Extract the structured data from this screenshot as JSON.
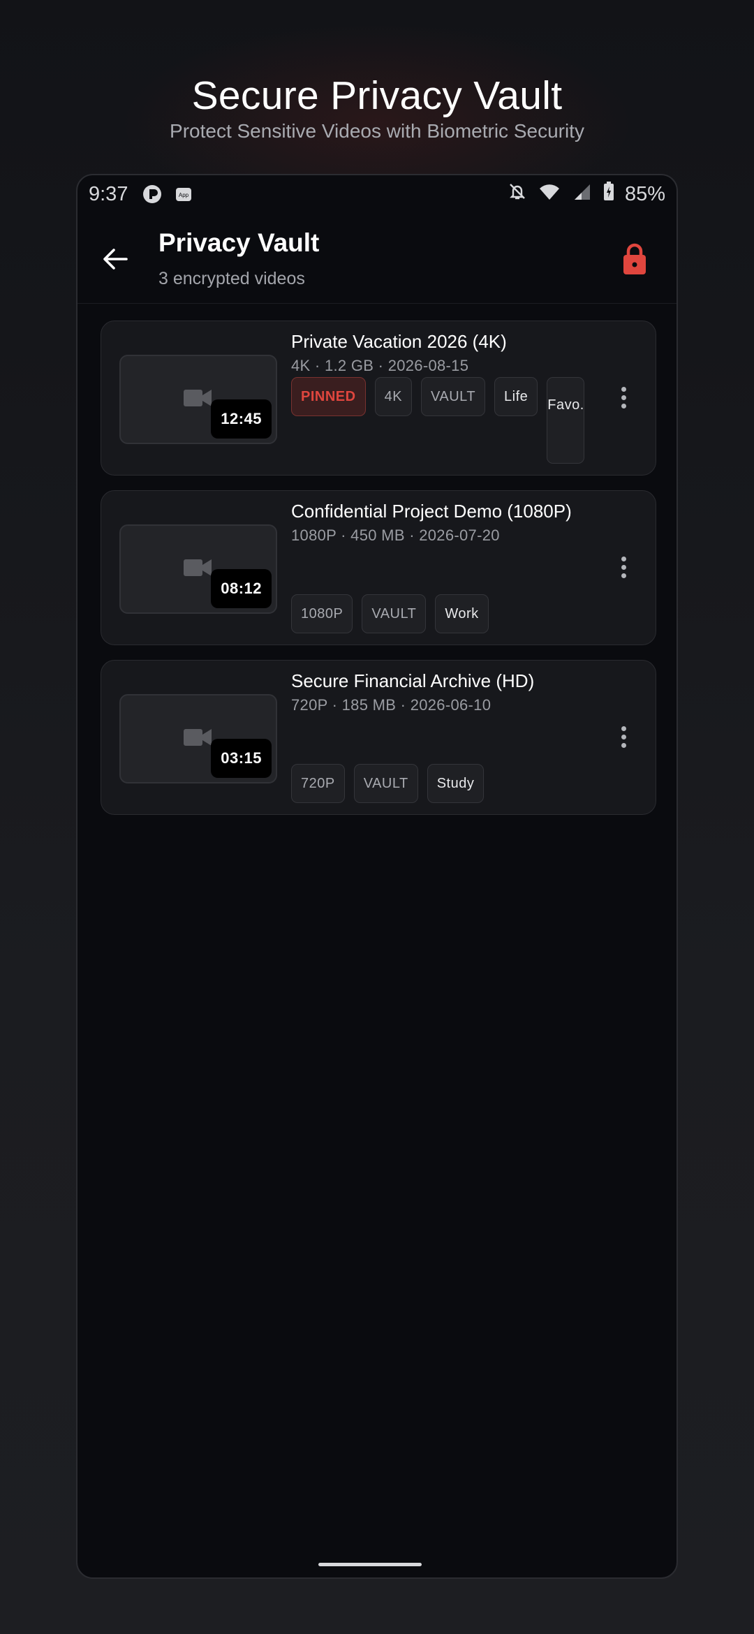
{
  "hero": {
    "title": "Secure Privacy Vault",
    "subtitle": "Protect Sensitive Videos with Biometric Security"
  },
  "status_bar": {
    "time": "9:37",
    "battery": "85%",
    "left_icons": [
      "app-badge-icon",
      "app-icon"
    ],
    "right_icons": [
      "bell-off-icon",
      "wifi-icon",
      "signal-icon",
      "battery-charging-icon"
    ]
  },
  "app_bar": {
    "title": "Privacy Vault",
    "subtitle": "3 encrypted videos",
    "accent_color": "#e0463e"
  },
  "videos": [
    {
      "title": "Private Vacation 2026 (4K)",
      "meta": "4K · 1.2 GB · 2026-08-15",
      "duration": "12:45",
      "pinned_label": "PINNED",
      "quality": "4K",
      "vault": "VAULT",
      "tags": [
        "Life"
      ],
      "overflow_tag": "Favo..."
    },
    {
      "title": "Confidential Project Demo (1080P)",
      "meta": "1080P · 450 MB · 2026-07-20",
      "duration": "08:12",
      "quality": "1080P",
      "vault": "VAULT",
      "tags": [
        "Work"
      ]
    },
    {
      "title": "Secure Financial Archive (HD)",
      "meta": "720P · 185 MB · 2026-06-10",
      "duration": "03:15",
      "quality": "720P",
      "vault": "VAULT",
      "tags": [
        "Study"
      ]
    }
  ]
}
